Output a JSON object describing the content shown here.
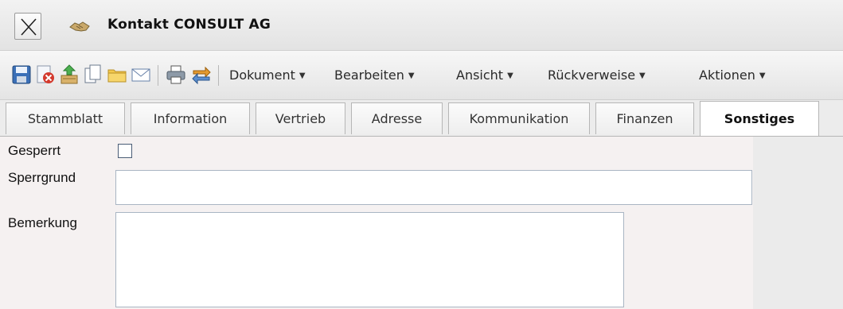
{
  "window": {
    "title": "Kontakt CONSULT AG"
  },
  "toolbar": {
    "icons": [
      "save-icon",
      "delete-icon",
      "upload-icon",
      "copy-icon",
      "folder-icon",
      "email-icon",
      "print-icon",
      "swap-icon"
    ],
    "menus": [
      {
        "label": "Dokument"
      },
      {
        "label": "Bearbeiten"
      },
      {
        "label": "Ansicht"
      },
      {
        "label": "Rückverweise"
      },
      {
        "label": "Aktionen"
      }
    ]
  },
  "tabs": [
    {
      "label": "Stammblatt",
      "active": false
    },
    {
      "label": "Information",
      "active": false
    },
    {
      "label": "Vertrieb",
      "active": false
    },
    {
      "label": "Adresse",
      "active": false
    },
    {
      "label": "Kommunikation",
      "active": false
    },
    {
      "label": "Finanzen",
      "active": false
    },
    {
      "label": "Sonstiges",
      "active": true
    }
  ],
  "form": {
    "gesperrt": {
      "label": "Gesperrt",
      "checked": false
    },
    "sperrgrund": {
      "label": "Sperrgrund",
      "value": ""
    },
    "bemerkung": {
      "label": "Bemerkung",
      "value": ""
    }
  },
  "colors": {
    "content_bg": "#f5f1f1",
    "input_border": "#a9b5c3",
    "checkbox_border": "#4a5d76"
  }
}
